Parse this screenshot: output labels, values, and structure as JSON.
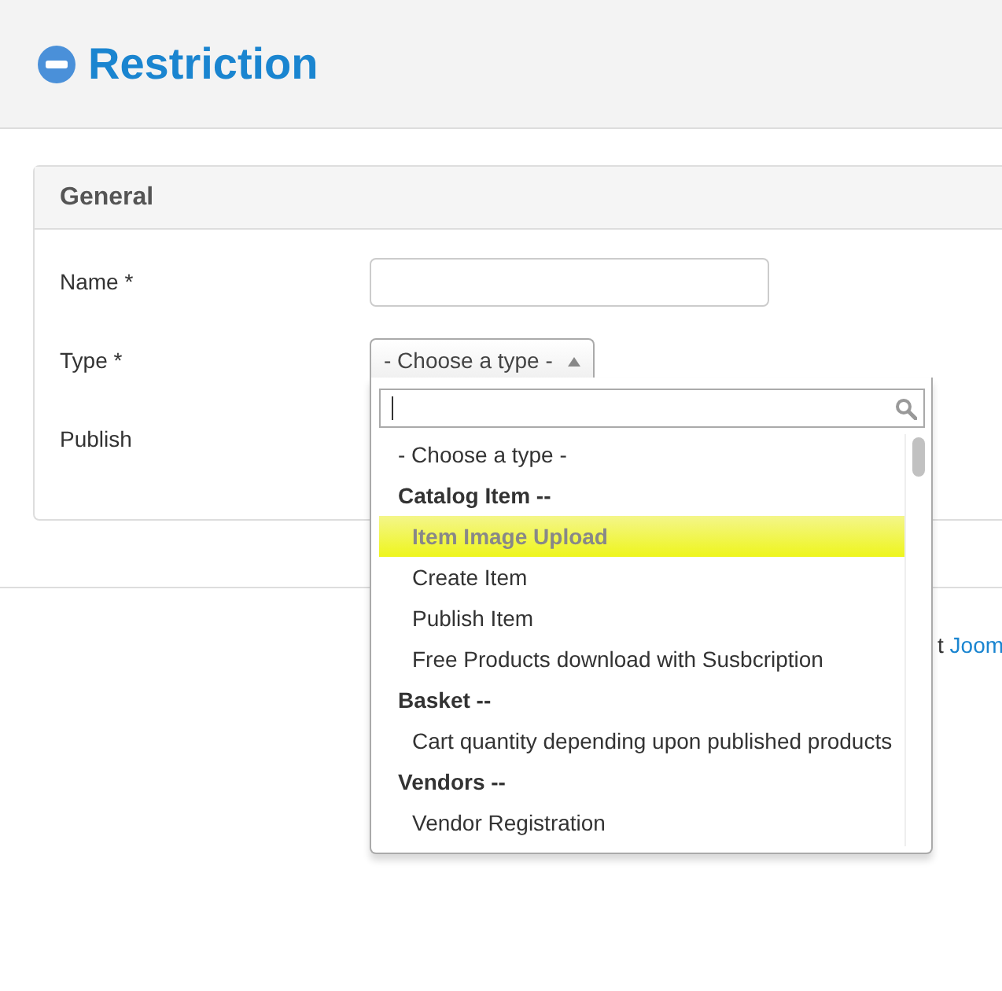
{
  "page_title": "Restriction",
  "panel": {
    "title": "General",
    "fields": [
      {
        "label": "Name *",
        "kind": "text"
      },
      {
        "label": "Type *",
        "kind": "select",
        "value": "- Choose a type -",
        "expanded": true
      },
      {
        "label": "Publish",
        "kind": "other"
      }
    ]
  },
  "dropdown": {
    "items": [
      {
        "kind": "option",
        "label": "- Choose a type -",
        "selected": false
      },
      {
        "kind": "group",
        "label": "Catalog Item --"
      },
      {
        "kind": "subitem",
        "label": "Item Image Upload",
        "selected": true
      },
      {
        "kind": "subitem",
        "label": "Create Item",
        "selected": false
      },
      {
        "kind": "subitem",
        "label": "Publish Item",
        "selected": false
      },
      {
        "kind": "subitem",
        "label": "Free Products download with Susbcription",
        "selected": false
      },
      {
        "kind": "group",
        "label": "Basket --"
      },
      {
        "kind": "subitem",
        "label": "Cart quantity depending upon published products",
        "selected": false
      },
      {
        "kind": "group",
        "label": "Vendors --"
      },
      {
        "kind": "subitem",
        "label": "Vendor Registration",
        "selected": false
      }
    ]
  },
  "footer": {
    "text": "t",
    "link": "Joom"
  }
}
